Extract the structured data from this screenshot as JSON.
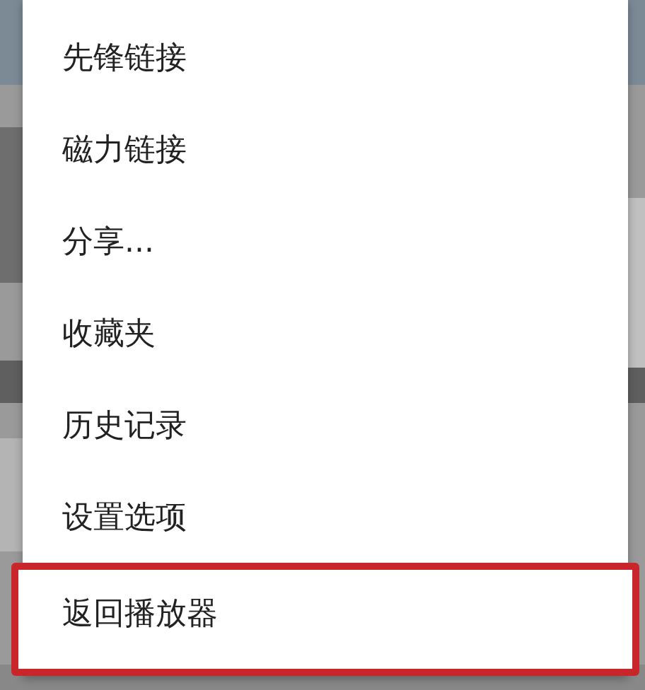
{
  "menu": {
    "items": [
      {
        "label": "先锋链接",
        "highlighted": false
      },
      {
        "label": "磁力链接",
        "highlighted": false
      },
      {
        "label": "分享...",
        "highlighted": false
      },
      {
        "label": "收藏夹",
        "highlighted": false
      },
      {
        "label": "历史记录",
        "highlighted": false
      },
      {
        "label": "设置选项",
        "highlighted": false
      },
      {
        "label": "返回播放器",
        "highlighted": true
      }
    ]
  }
}
